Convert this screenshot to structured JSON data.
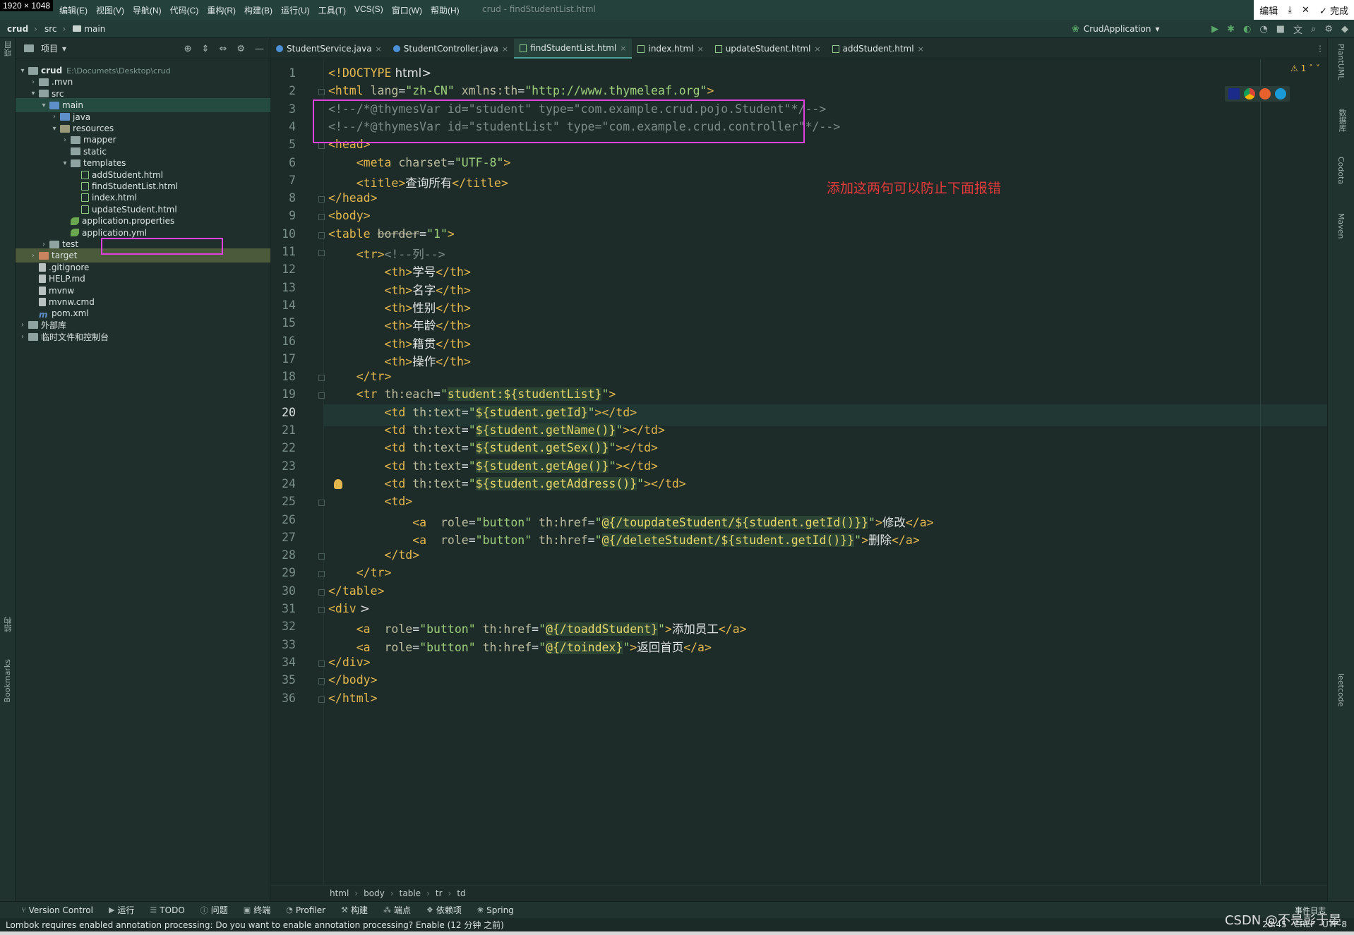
{
  "screen": {
    "resolution_badge": "1920 × 1048"
  },
  "menubar": {
    "items": [
      "编辑(E)",
      "视图(V)",
      "导航(N)",
      "代码(C)",
      "重构(R)",
      "构建(B)",
      "运行(U)",
      "工具(T)",
      "VCS(S)",
      "窗口(W)",
      "帮助(H)"
    ],
    "window_title": "crud - findStudentList.html",
    "edit_label": "编辑",
    "done_label": "完成"
  },
  "navbar": {
    "crumbs": [
      "crud",
      "src",
      "main"
    ],
    "run_config": "CrudApplication"
  },
  "project_panel": {
    "title": "项目",
    "root_path": "E:\\Documets\\Desktop\\crud",
    "tree": [
      {
        "label": "crud",
        "depth": 0
      },
      {
        "label": ".mvn",
        "depth": 1
      },
      {
        "label": "src",
        "depth": 1
      },
      {
        "label": "main",
        "depth": 2
      },
      {
        "label": "java",
        "depth": 3
      },
      {
        "label": "resources",
        "depth": 3
      },
      {
        "label": "mapper",
        "depth": 4
      },
      {
        "label": "static",
        "depth": 4
      },
      {
        "label": "templates",
        "depth": 4
      },
      {
        "label": "addStudent.html",
        "depth": 5
      },
      {
        "label": "findStudentList.html",
        "depth": 5
      },
      {
        "label": "index.html",
        "depth": 5
      },
      {
        "label": "updateStudent.html",
        "depth": 5
      },
      {
        "label": "application.properties",
        "depth": 4
      },
      {
        "label": "application.yml",
        "depth": 4
      },
      {
        "label": "test",
        "depth": 2
      },
      {
        "label": "target",
        "depth": 1
      },
      {
        "label": ".gitignore",
        "depth": 1
      },
      {
        "label": "HELP.md",
        "depth": 1
      },
      {
        "label": "mvnw",
        "depth": 1
      },
      {
        "label": "mvnw.cmd",
        "depth": 1
      },
      {
        "label": "pom.xml",
        "depth": 1
      },
      {
        "label": "外部库",
        "depth": 0
      },
      {
        "label": "临时文件和控制台",
        "depth": 0
      }
    ]
  },
  "tabs": [
    {
      "label": "StudentService.java"
    },
    {
      "label": "StudentController.java"
    },
    {
      "label": "findStudentList.html",
      "active": true
    },
    {
      "label": "index.html"
    },
    {
      "label": "updateStudent.html"
    },
    {
      "label": "addStudent.html"
    }
  ],
  "left_strip": {
    "project": "项目",
    "structure": "结构",
    "bookmarks": "Bookmarks"
  },
  "right_strip": {
    "plantuml": "PlantUML",
    "database": "数据库",
    "codota": "Codota",
    "maven": "Maven",
    "leetcode": "leetcode"
  },
  "editor": {
    "warning_count": "1",
    "current_line": 20,
    "annotation": "添加这两句可以防止下面报错",
    "line_numbers": [
      "1",
      "2",
      "3",
      "4",
      "5",
      "6",
      "7",
      "8",
      "9",
      "10",
      "11",
      "12",
      "13",
      "14",
      "15",
      "16",
      "17",
      "18",
      "19",
      "20",
      "21",
      "22",
      "23",
      "24",
      "25",
      "26",
      "27",
      "28",
      "29",
      "30",
      "31",
      "32",
      "33",
      "34",
      "35",
      "36"
    ],
    "lines": [
      "<!DOCTYPE html>",
      "<html lang=\"zh-CN\" xmlns:th=\"http://www.thymeleaf.org\">",
      "<!--/*@thymesVar id=\"student\" type=\"com.example.crud.pojo.Student\"*/-->",
      "<!--/*@thymesVar id=\"studentList\" type=\"com.example.crud.controller\"*/-->",
      "<head>",
      "    <meta charset=\"UTF-8\">",
      "    <title>查询所有</title>",
      "</head>",
      "<body>",
      "<table border=\"1\">",
      "    <tr><!--列-->",
      "        <th>学号</th>",
      "        <th>名字</th>",
      "        <th>性别</th>",
      "        <th>年龄</th>",
      "        <th>籍贯</th>",
      "        <th>操作</th>",
      "    </tr>",
      "    <tr th:each=\"student:${studentList}\">",
      "        <td th:text=\"${student.getId}\"></td>",
      "        <td th:text=\"${student.getName()}\"></td>",
      "        <td th:text=\"${student.getSex()}\"></td>",
      "        <td th:text=\"${student.getAge()}\"></td>",
      "        <td th:text=\"${student.getAddress()}\"></td>",
      "        <td>",
      "            <a  role=\"button\" th:href=\"@{/toupdateStudent/${student.getId()}}\">修改</a>",
      "            <a  role=\"button\" th:href=\"@{/deleteStudent/${student.getId()}}\">删除</a>",
      "        </td>",
      "    </tr>",
      "</table>",
      "<div >",
      "    <a  role=\"button\" th:href=\"@{/toaddStudent}\">添加员工</a>",
      "    <a  role=\"button\" th:href=\"@{/toindex}\">返回首页</a>",
      "</div>",
      "</body>",
      "</html>"
    ]
  },
  "code_breadcrumb": [
    "html",
    "body",
    "table",
    "tr",
    "td"
  ],
  "bottom_tools": [
    "Version Control",
    "运行",
    "TODO",
    "问题",
    "终端",
    "Profiler",
    "构建",
    "端点",
    "依赖项",
    "Spring"
  ],
  "event_log": "事件日志",
  "status": {
    "message": "Lombok requires enabled annotation processing: Do you want to enable annotation processing? Enable (12 分钟 之前)",
    "time": "20:45",
    "line_sep": "CRLF",
    "encoding": "UTF-8"
  },
  "watermark": "CSDN @不是彭于晏"
}
